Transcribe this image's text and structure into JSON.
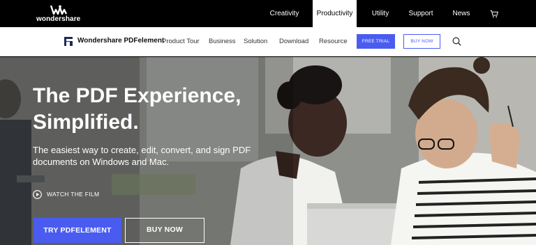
{
  "topbar": {
    "brand": "wondershare",
    "nav": [
      {
        "label": "Creativity",
        "active": false
      },
      {
        "label": "Productivity",
        "active": true
      },
      {
        "label": "Utility",
        "active": false
      },
      {
        "label": "Support",
        "active": false
      },
      {
        "label": "News",
        "active": false
      }
    ],
    "cart_icon": "cart-icon"
  },
  "subnav": {
    "product_name": "Wondershare PDFelement",
    "items": [
      "Product Tour",
      "Business",
      "Solution",
      "Download",
      "Resource"
    ],
    "free_trial": "FREE TRIAL",
    "buy_now": "BUY NOW",
    "search_icon": "search-icon"
  },
  "hero": {
    "title": "The PDF Experience, Simplified.",
    "subtitle": "The easiest way to create, edit, convert, and sign PDF documents on Windows and Mac.",
    "watch_label": "WATCH THE FILM",
    "try_button": "TRY PDFELEMENT",
    "buy_button": "BUY NOW"
  },
  "colors": {
    "accent": "#4a5cf0",
    "topbar_bg": "#000000",
    "subnav_bg": "#ffffff"
  }
}
